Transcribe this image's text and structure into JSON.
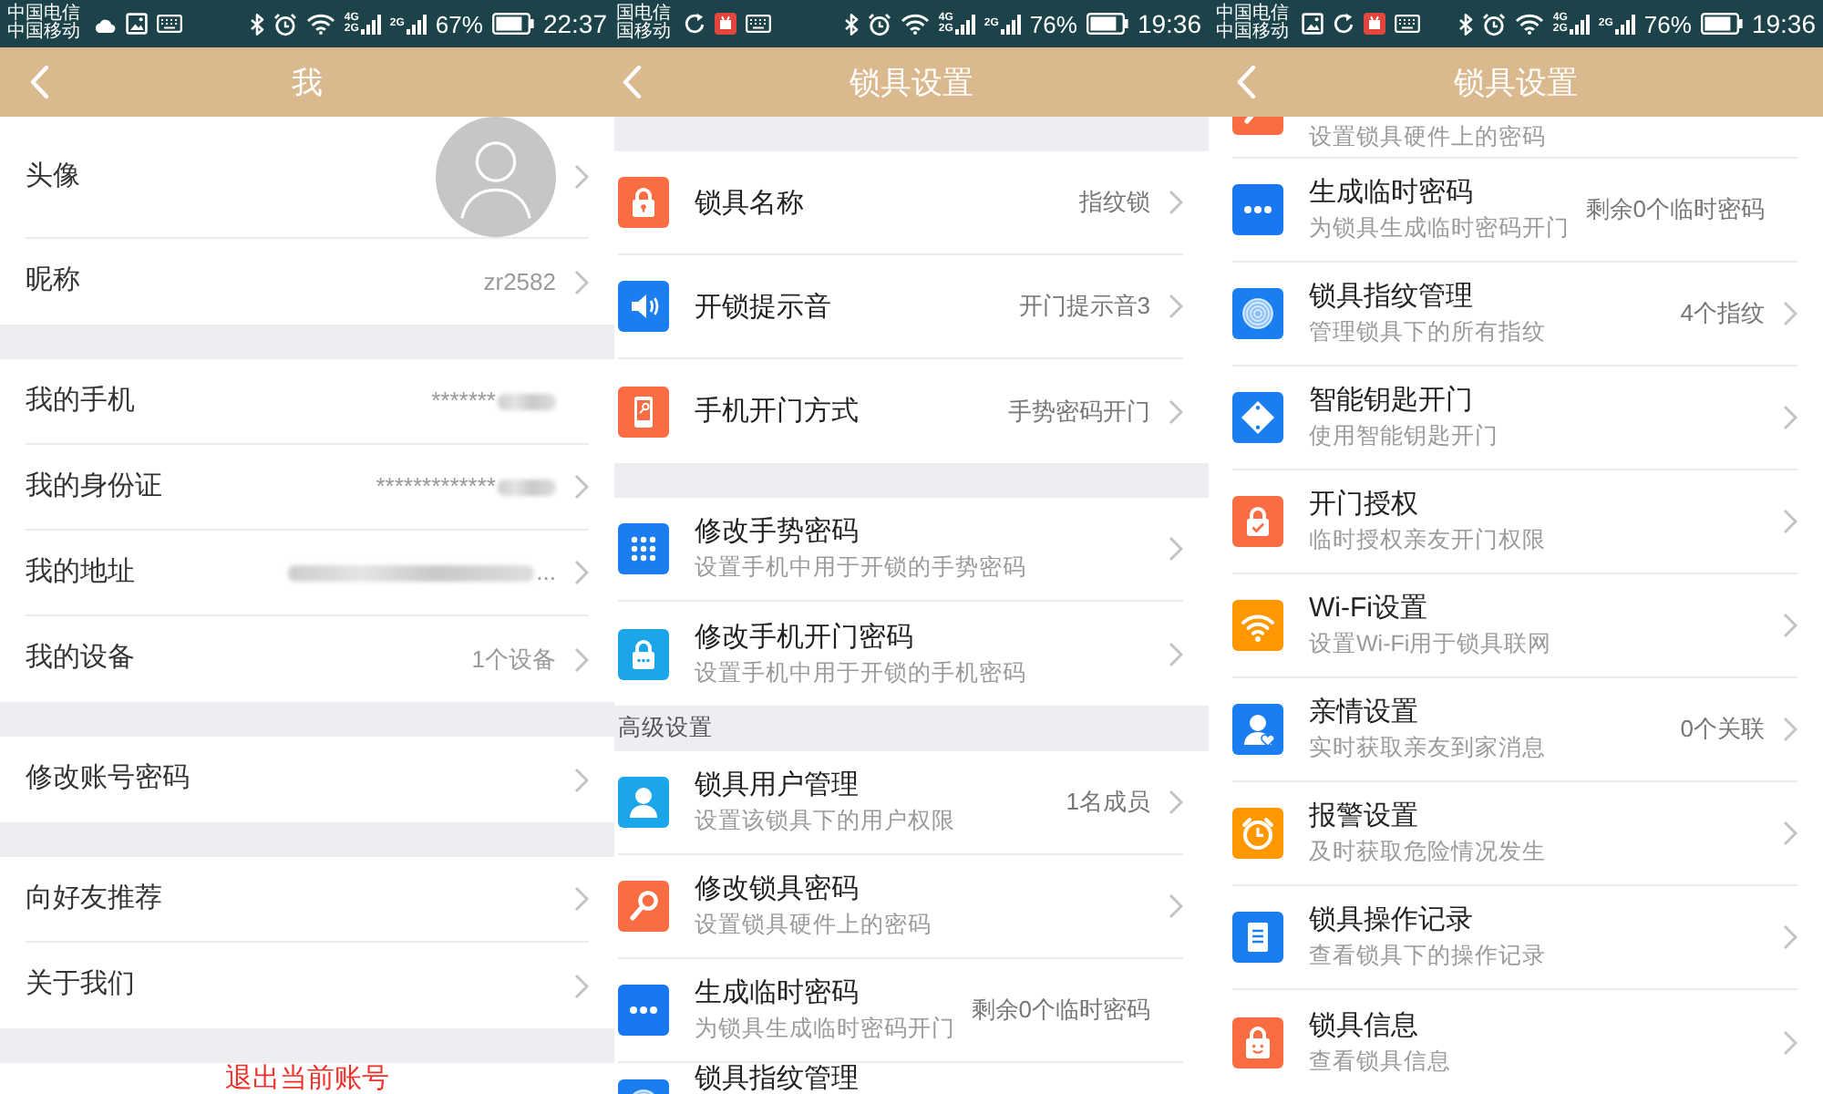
{
  "screens": [
    {
      "status_bar": {
        "carriers": [
          "中国电信",
          "中国移动"
        ],
        "notification_icons": [
          {
            "kind": "cloud"
          },
          {
            "kind": "image"
          },
          {
            "kind": "keyboard"
          }
        ],
        "sims": [
          {
            "labels": [
              "4G",
              "2G"
            ]
          },
          {
            "labels": [
              "2G"
            ]
          }
        ],
        "battery": "67%",
        "time": "22:37"
      },
      "header": {
        "title": "我"
      },
      "sections": [
        {
          "kind": "list",
          "rows": [
            {
              "kind": "avatar",
              "label": "头像",
              "chevron": true
            },
            {
              "kind": "field",
              "label": "昵称",
              "value_parts": [
                {
                  "kind": "text",
                  "text": "zr2582"
                }
              ],
              "chevron": true
            }
          ]
        },
        {
          "kind": "gap"
        },
        {
          "kind": "list",
          "rows": [
            {
              "kind": "field",
              "label": "我的手机",
              "value_parts": [
                {
                  "kind": "text",
                  "text": "*******"
                },
                {
                  "kind": "blur"
                }
              ],
              "chevron": false
            },
            {
              "kind": "field",
              "label": "我的身份证",
              "value_parts": [
                {
                  "kind": "text",
                  "text": "*************"
                },
                {
                  "kind": "blur"
                }
              ],
              "chevron": true
            },
            {
              "kind": "field",
              "label": "我的地址",
              "value_parts": [
                {
                  "kind": "blur"
                },
                {
                  "kind": "text",
                  "text": "..."
                }
              ],
              "chevron": true
            },
            {
              "kind": "field",
              "label": "我的设备",
              "value_parts": [
                {
                  "kind": "text",
                  "text": "1个设备"
                }
              ],
              "chevron": true
            }
          ]
        },
        {
          "kind": "gap"
        },
        {
          "kind": "list",
          "rows": [
            {
              "kind": "field",
              "label": "修改账号密码",
              "chevron": true
            }
          ]
        },
        {
          "kind": "gap"
        },
        {
          "kind": "list",
          "rows": [
            {
              "kind": "field",
              "label": "向好友推荐",
              "chevron": true
            },
            {
              "kind": "field",
              "label": "关于我们",
              "chevron": true
            }
          ]
        },
        {
          "kind": "gap"
        },
        {
          "kind": "list",
          "rows": [
            {
              "kind": "action",
              "label": "退出当前账号"
            }
          ]
        }
      ]
    },
    {
      "status_bar": {
        "carriers": [
          "国电信",
          "国移动"
        ],
        "notification_icons": [
          {
            "kind": "sync"
          },
          {
            "kind": "app"
          },
          {
            "kind": "keyboard"
          }
        ],
        "sims": [
          {
            "labels": [
              "4G",
              "2G"
            ]
          },
          {
            "labels": [
              "2G"
            ]
          }
        ],
        "battery": "76%",
        "time": "19:36"
      },
      "header": {
        "title": "锁具设置"
      },
      "sections": [
        {
          "kind": "gap"
        },
        {
          "kind": "list",
          "rows": [
            {
              "kind": "lock",
              "title": "锁具名称",
              "value": "指纹锁",
              "chevron": true
            },
            {
              "kind": "speaker",
              "title": "开锁提示音",
              "value": "开门提示音3",
              "chevron": true
            },
            {
              "kind": "phone",
              "title": "手机开门方式",
              "value": "手势密码开门",
              "chevron": true
            }
          ]
        },
        {
          "kind": "gap"
        },
        {
          "kind": "list",
          "rows": [
            {
              "kind": "keypad",
              "title": "修改手势密码",
              "subtitle": "设置手机中用于开锁的手势密码",
              "chevron": true
            },
            {
              "kind": "padlock_dots",
              "title": "修改手机开门密码",
              "subtitle": "设置手机中用于开锁的手机密码",
              "chevron": true
            }
          ]
        },
        {
          "kind": "heading",
          "text": "高级设置"
        },
        {
          "kind": "list",
          "rows": [
            {
              "kind": "user",
              "title": "锁具用户管理",
              "subtitle": "设置该锁具下的用户权限",
              "value": "1名成员",
              "chevron": true
            },
            {
              "kind": "key",
              "title": "修改锁具密码",
              "subtitle": "设置锁具硬件上的密码",
              "chevron": true
            },
            {
              "kind": "dots",
              "title": "生成临时密码",
              "subtitle": "为锁具生成临时密码开门",
              "value": "剩余0个临时密码",
              "chevron": false
            },
            {
              "kind": "fingerprint",
              "title": "锁具指纹管理",
              "chevron": false
            }
          ]
        }
      ]
    },
    {
      "status_bar": {
        "carriers": [
          "中国电信",
          "中国移动"
        ],
        "notification_icons": [
          {
            "kind": "image"
          },
          {
            "kind": "sync"
          },
          {
            "kind": "app"
          },
          {
            "kind": "keyboard"
          }
        ],
        "sims": [
          {
            "labels": [
              "4G",
              "2G"
            ]
          },
          {
            "labels": [
              "2G"
            ]
          }
        ],
        "battery": "76%",
        "time": "19:36"
      },
      "header": {
        "title": "锁具设置"
      },
      "sections": [
        {
          "kind": "list",
          "rows": [
            {
              "kind": "key",
              "subtitle": "设置锁具硬件上的密码",
              "chevron": false
            },
            {
              "kind": "dots",
              "title": "生成临时密码",
              "subtitle": "为锁具生成临时密码开门",
              "value": "剩余0个临时密码",
              "chevron": false
            },
            {
              "kind": "fingerprint",
              "title": "锁具指纹管理",
              "subtitle": "管理锁具下的所有指纹",
              "value": "4个指纹",
              "chevron": true
            },
            {
              "kind": "diamond",
              "title": "智能钥匙开门",
              "subtitle": "使用智能钥匙开门",
              "chevron": true
            },
            {
              "kind": "padlock_check",
              "title": "开门授权",
              "subtitle": "临时授权亲友开门权限",
              "chevron": true
            },
            {
              "kind": "wifi",
              "title": "Wi-Fi设置",
              "subtitle": "设置Wi-Fi用于锁具联网",
              "chevron": true
            },
            {
              "kind": "user_heart",
              "title": "亲情设置",
              "subtitle": "实时获取亲友到家消息",
              "value": "0个关联",
              "chevron": true
            },
            {
              "kind": "alarm",
              "title": "报警设置",
              "subtitle": "及时获取危险情况发生",
              "chevron": true
            },
            {
              "kind": "document",
              "title": "锁具操作记录",
              "subtitle": "查看锁具下的操作记录",
              "chevron": true
            },
            {
              "kind": "padlock_face",
              "title": "锁具信息",
              "subtitle": "查看锁具信息",
              "chevron": true
            }
          ]
        }
      ]
    }
  ]
}
